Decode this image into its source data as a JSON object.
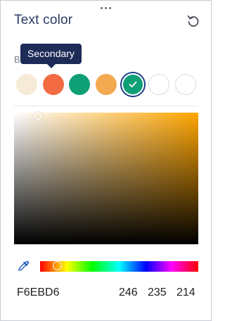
{
  "panel": {
    "title": "Text color",
    "section_label": "B",
    "tooltip": "Secondary"
  },
  "icons": {
    "reset": "undo-icon",
    "drag": "drag-handle-icon",
    "check": "check-icon",
    "eyedropper": "eyedropper-icon"
  },
  "swatches": [
    {
      "color": "#f6ebd6",
      "selected": false
    },
    {
      "color": "#f26b43",
      "selected": false
    },
    {
      "color": "#0e9f75",
      "selected": false
    },
    {
      "color": "#f2a950",
      "selected": false
    },
    {
      "color": "#0e9f75",
      "selected": true
    },
    {
      "color": "#ffffff",
      "selected": false
    },
    {
      "color": "#ffffff",
      "selected": false
    }
  ],
  "picker": {
    "hue_color": "#ffa500",
    "hex": "F6EBD6",
    "r": "246",
    "g": "235",
    "b": "214"
  },
  "colors": {
    "accent_dark": "#1d2b57",
    "selected_ring": "#1d3f8a"
  }
}
